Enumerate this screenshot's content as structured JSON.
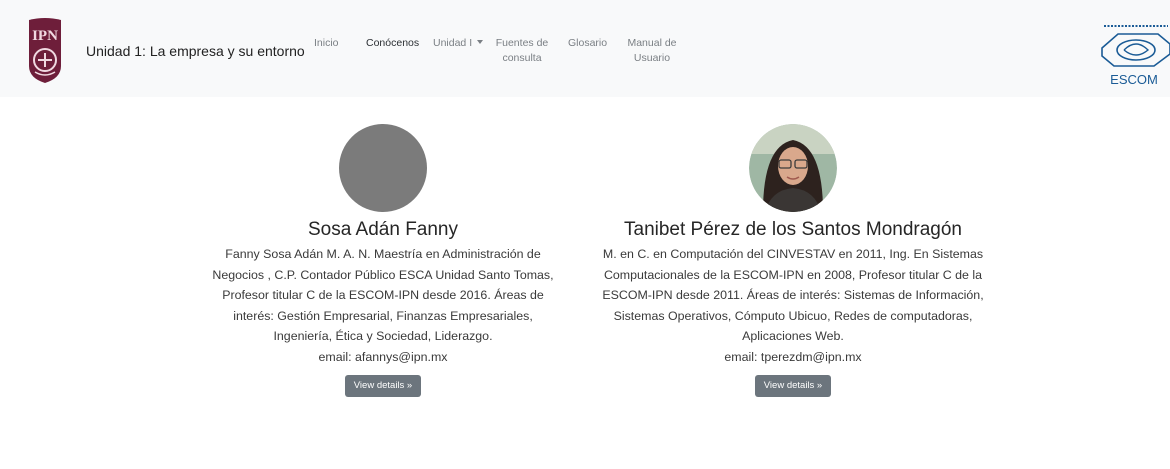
{
  "navbar": {
    "brand": "Unidad 1: La empresa y su entorno",
    "items": [
      {
        "label": "Inicio"
      },
      {
        "label": "Conócenos",
        "active": true
      },
      {
        "label": "Unidad I"
      },
      {
        "line1": "Fuentes de",
        "line2": "consulta"
      },
      {
        "label": "Glosario"
      },
      {
        "line1": "Manual de",
        "line2": "Usuario"
      }
    ],
    "right_logo_text": "ESCOM",
    "left_logo_text": "IPN"
  },
  "people": [
    {
      "name": "Sosa Adán Fanny",
      "bio": "Fanny Sosa Adán M. A. N. Maestría en Administración de Negocios , C.P. Contador Público ESCA Unidad Santo Tomas, Profesor titular C de la ESCOM-IPN desde 2016. Áreas de interés: Gestión Empresarial, Finanzas Empresariales, Ingeniería, Ética y Sociedad, Liderazgo.",
      "email": "email: afannys@ipn.mx",
      "button": "View details »"
    },
    {
      "name": "Tanibet Pérez de los Santos Mondragón",
      "bio": "M. en C. en Computación del CINVESTAV en 2011, Ing. En Sistemas Computacionales de la ESCOM-IPN en 2008, Profesor titular C de la ESCOM-IPN desde 2011. Áreas de interés: Sistemas de Información, Sistemas Operativos, Cómputo Ubicuo, Redes de computadoras, Aplicaciones Web.",
      "email": "email: tperezdm@ipn.mx",
      "button": "View details »"
    }
  ],
  "colors": {
    "navbar_bg": "#f8f9fa",
    "ipn_guinda": "#6e1e3a",
    "escom_blue": "#1a5b96",
    "button_bg": "#6c757d"
  }
}
